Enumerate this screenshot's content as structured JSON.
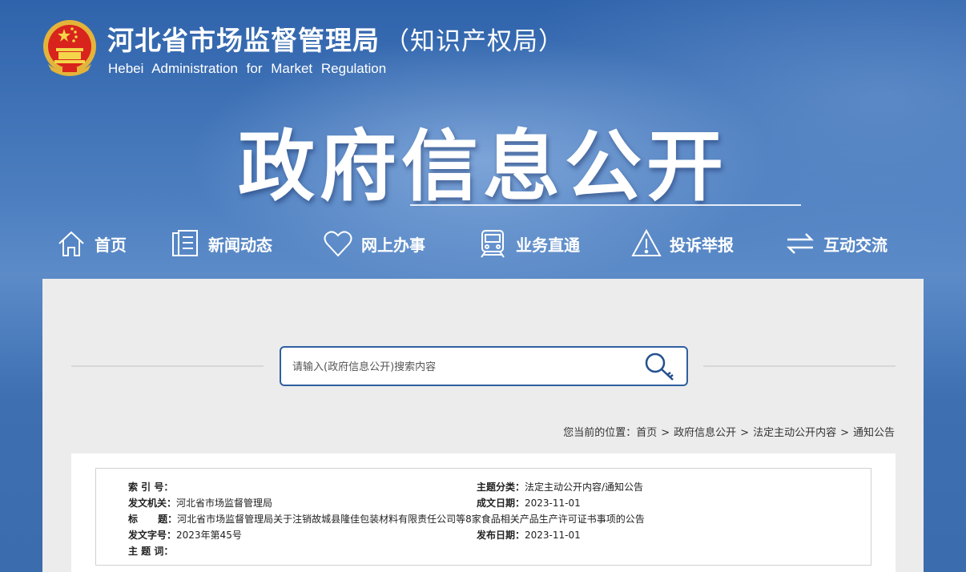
{
  "header": {
    "org_name_cn": "河北省市场监督管理局",
    "org_suffix": "（知识产权局）",
    "org_name_en": "Hebei Administration for Market Regulation"
  },
  "banner_title": "政府信息公开",
  "nav": [
    {
      "label": "首页",
      "icon": "home-icon"
    },
    {
      "label": "新闻动态",
      "icon": "news-icon"
    },
    {
      "label": "网上办事",
      "icon": "heart-icon"
    },
    {
      "label": "业务直通",
      "icon": "train-icon"
    },
    {
      "label": "投诉举报",
      "icon": "warning-icon"
    },
    {
      "label": "互动交流",
      "icon": "exchange-icon"
    }
  ],
  "search": {
    "placeholder": "请输入(政府信息公开)搜索内容"
  },
  "breadcrumb": {
    "prefix": "您当前的位置：",
    "items": [
      "首页",
      "政府信息公开",
      "法定主动公开内容",
      "通知公告"
    ],
    "separator": ">"
  },
  "info": {
    "index_label": "索 引 号：",
    "index_value": "",
    "category_label": "主题分类：",
    "category_value": "法定主动公开内容/通知公告",
    "issuer_label": "发文机关：",
    "issuer_value": "河北省市场监督管理局",
    "created_label": "成文日期：",
    "created_value": "2023-11-01",
    "title_label": "标      题：",
    "title_value": "河北省市场监督管理局关于注销故城县隆佳包装材料有限责任公司等8家食品相关产品生产许可证书事项的公告",
    "docno_label": "发文字号：",
    "docno_value": "2023年第45号",
    "published_label": "发布日期：",
    "published_value": "2023-11-01",
    "keywords_label": "主 题 词：",
    "keywords_value": ""
  },
  "colors": {
    "accent": "#2f5f9f",
    "banner": "#3f72b4",
    "panel": "#ececec"
  }
}
